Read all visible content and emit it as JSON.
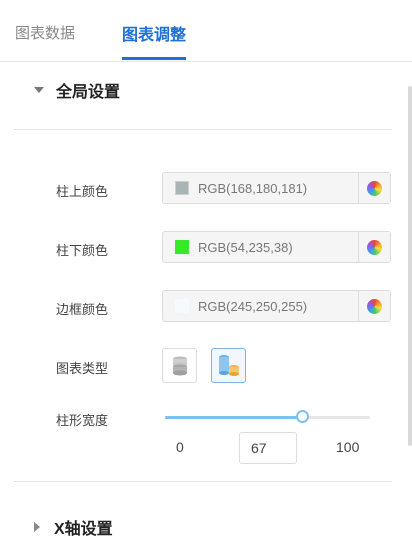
{
  "tabs": [
    {
      "label": "图表数据",
      "active": false
    },
    {
      "label": "图表调整",
      "active": true
    }
  ],
  "sections": {
    "global": {
      "title": "全局设置",
      "expanded": true
    },
    "xaxis": {
      "title": "X轴设置",
      "expanded": false
    }
  },
  "colors": {
    "accent": "#1e6fd9",
    "slider": "#7cc1ea"
  },
  "fields": {
    "top_color": {
      "label": "柱上颜色",
      "value": "RGB(168,180,181)",
      "swatch": "#a8b4b5"
    },
    "bottom_color": {
      "label": "柱下颜色",
      "value": "RGB(54,235,38)",
      "swatch": "#36eb26"
    },
    "border_color": {
      "label": "边框颜色",
      "value": "RGB(245,250,255)",
      "swatch": "#f5faff"
    },
    "chart_type": {
      "label": "图表类型",
      "options": [
        "gray-cylinder-icon",
        "blue-orange-cylinder-icon"
      ],
      "selected": 1
    },
    "bar_width": {
      "label": "柱形宽度",
      "min": "0",
      "max": "100",
      "value": "67"
    }
  }
}
